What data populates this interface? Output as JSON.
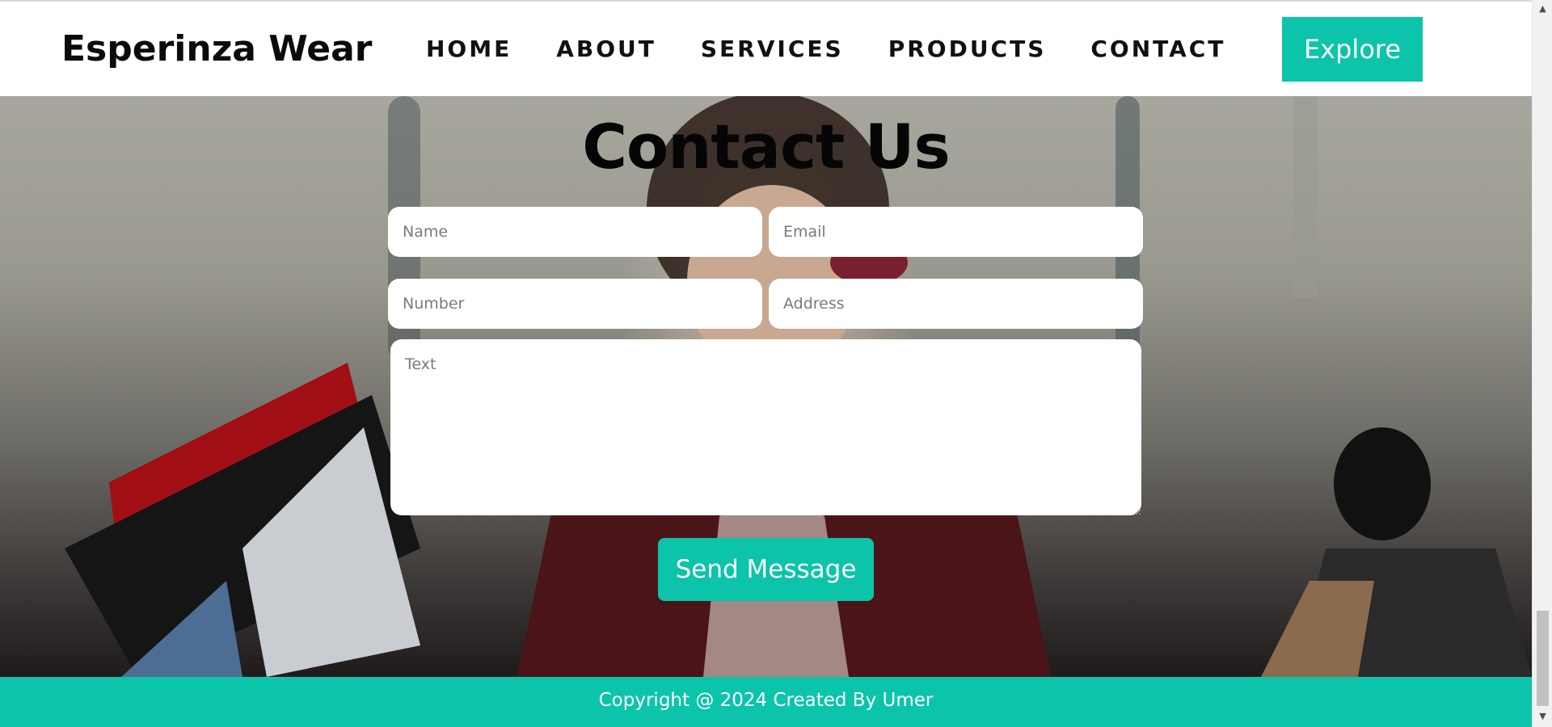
{
  "header": {
    "logo": "Esperinza Wear",
    "nav": [
      "HOME",
      "ABOUT",
      "SERVICES",
      "PRODUCTS",
      "CONTACT"
    ],
    "explore_label": "Explore"
  },
  "contact": {
    "title": "Contact Us",
    "fields": {
      "name_placeholder": "Name",
      "email_placeholder": "Email",
      "number_placeholder": "Number",
      "address_placeholder": "Address",
      "text_placeholder": "Text"
    },
    "send_label": "Send Message"
  },
  "footer": {
    "copyright": "Copyright @ 2024 Created By Umer"
  },
  "colors": {
    "accent": "#0bc4aa",
    "text_dark": "#0b0b0b",
    "header_bg": "#ffffff"
  },
  "scrollbar": {
    "up_icon": "▲",
    "down_icon": "▼"
  }
}
